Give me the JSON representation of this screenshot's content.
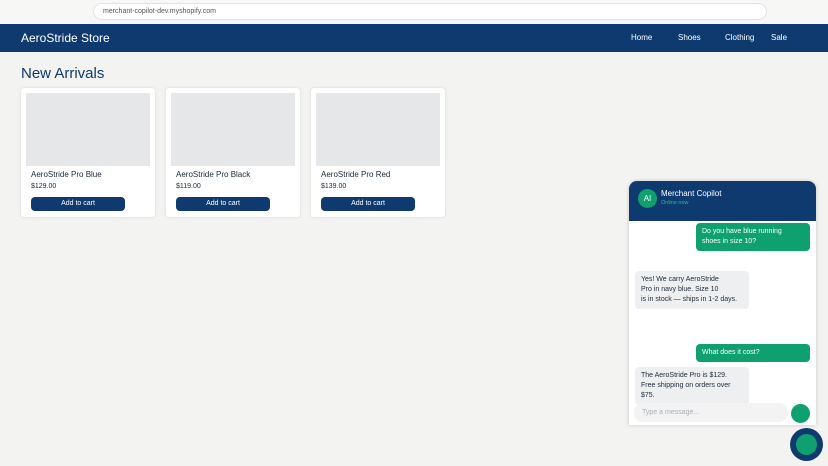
{
  "browser": {
    "url": "merchant-copilot-dev.myshopify.com"
  },
  "store": {
    "name": "AeroStride Store",
    "nav": [
      "Home",
      "Shoes",
      "Clothing",
      "Sale"
    ]
  },
  "section_title": "New Arrivals",
  "products": [
    {
      "name": "AeroStride Pro Blue",
      "price": "$129.00",
      "button": "Add to cart"
    },
    {
      "name": "AeroStride Pro Black",
      "price": "$119.00",
      "button": "Add to cart"
    },
    {
      "name": "AeroStride Pro Red",
      "price": "$139.00",
      "button": "Add to cart"
    }
  ],
  "chat": {
    "avatar_initials": "AI",
    "title": "Merchant Copilot",
    "status": "Online now",
    "messages": [
      {
        "role": "user",
        "lines": [
          "Do you have blue running",
          "shoes in size 10?"
        ]
      },
      {
        "role": "bot",
        "lines": [
          "Yes! We carry AeroStride",
          "Pro in navy blue. Size 10",
          "is in stock — ships in 1-2 days."
        ]
      },
      {
        "role": "user",
        "lines": [
          "What does it cost?"
        ]
      },
      {
        "role": "bot",
        "lines": [
          "The AeroStride Pro is $129.",
          "Free shipping on orders over $75."
        ]
      }
    ],
    "input_placeholder": "Type a message..."
  },
  "colors": {
    "navy": "#0e3a70",
    "accent_green": "#0ea06e",
    "background": "#f3f3f1"
  }
}
